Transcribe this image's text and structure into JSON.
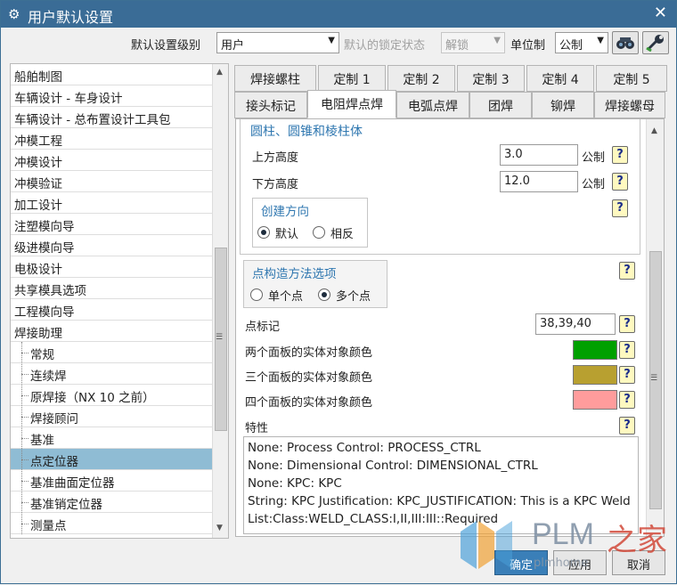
{
  "window": {
    "title": "用户默认设置",
    "close_glyph": "✕"
  },
  "toolbar": {
    "level_label": "默认设置级别",
    "level_value": "用户",
    "lock_label": "默认的锁定状态",
    "lock_value": "解锁",
    "unit_label": "单位制",
    "unit_value": "公制"
  },
  "left_list": {
    "items": [
      {
        "label": "船舶制图",
        "child": false
      },
      {
        "label": "车辆设计 - 车身设计",
        "child": false
      },
      {
        "label": "车辆设计 - 总布置设计工具包",
        "child": false
      },
      {
        "label": "冲模工程",
        "child": false
      },
      {
        "label": "冲模设计",
        "child": false
      },
      {
        "label": "冲模验证",
        "child": false
      },
      {
        "label": "加工设计",
        "child": false
      },
      {
        "label": "注塑模向导",
        "child": false
      },
      {
        "label": "级进模向导",
        "child": false
      },
      {
        "label": "电极设计",
        "child": false
      },
      {
        "label": "共享模具选项",
        "child": false
      },
      {
        "label": "工程模向导",
        "child": false
      },
      {
        "label": "焊接助理",
        "child": false
      },
      {
        "label": "常规",
        "child": true
      },
      {
        "label": "连续焊",
        "child": true
      },
      {
        "label": "原焊接（NX 10 之前）",
        "child": true
      },
      {
        "label": "焊接顾问",
        "child": true
      },
      {
        "label": "基准",
        "child": true
      },
      {
        "label": "点定位器",
        "child": true,
        "selected": true
      },
      {
        "label": "基准曲面定位器",
        "child": true
      },
      {
        "label": "基准销定位器",
        "child": true
      },
      {
        "label": "测量点",
        "child": true
      }
    ]
  },
  "tabs_row1": [
    "焊接螺柱",
    "定制 1",
    "定制 2",
    "定制 3",
    "定制 4",
    "定制 5"
  ],
  "tabs_row2": [
    "接头标记",
    "电阻焊点焊",
    "电弧点焊",
    "团焊",
    "铆焊",
    "焊接螺母"
  ],
  "content": {
    "group1_title": "圆柱、圆锥和棱柱体",
    "upper_height_label": "上方高度",
    "upper_height_value": "3.0",
    "lower_height_label": "下方高度",
    "lower_height_value": "12.0",
    "unit": "公制",
    "direction_title": "创建方向",
    "dir_default": "默认",
    "dir_reverse": "相反",
    "method_title": "点构造方法选项",
    "method_single": "单个点",
    "method_multi": "多个点",
    "point_mark_label": "点标记",
    "point_mark_value": "38,39,40",
    "color2_label": "两个面板的实体对象颜色",
    "color3_label": "三个面板的实体对象颜色",
    "color4_label": "四个面板的实体对象颜色",
    "colors": {
      "two": "#00a000",
      "three": "#b8a030",
      "four": "#ff9c9c"
    },
    "props_label": "特性",
    "props_lines": [
      "None: Process Control: PROCESS_CTRL",
      "None: Dimensional Control: DIMENSIONAL_CTRL",
      "None: KPC: KPC",
      "String: KPC Justification: KPC_JUSTIFICATION: This is a KPC Weld",
      "List:Class:WELD_CLASS:I,II,III:III::Required"
    ],
    "help_glyph": "?"
  },
  "buttons": {
    "ok": "确定",
    "apply": "应用",
    "cancel": "取消"
  },
  "watermark": {
    "brand": "PLM",
    "brand_cn": "之家",
    "url": "plmhome"
  }
}
